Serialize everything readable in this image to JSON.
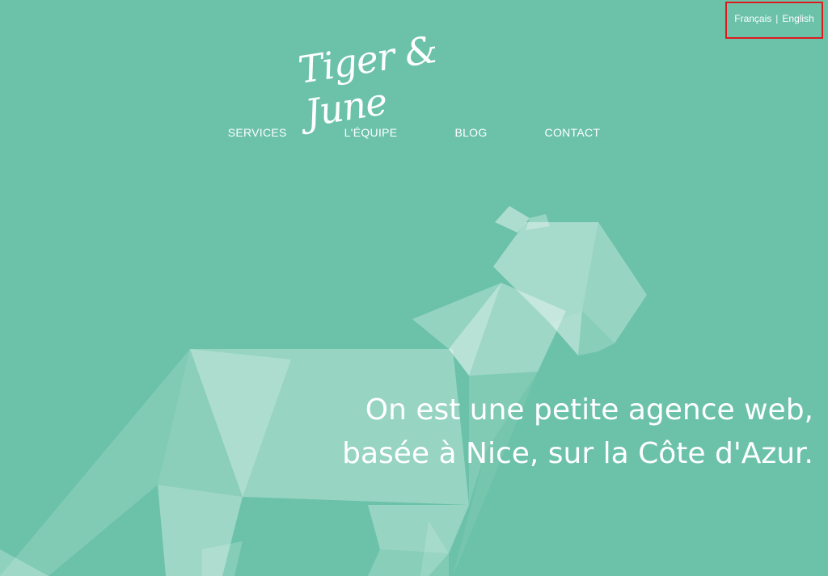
{
  "lang": {
    "french": "Français",
    "separator": "|",
    "english": "English"
  },
  "logo": {
    "text": "Tiger & June"
  },
  "nav": {
    "items": [
      "SERVICES",
      "L'ÉQUIPE",
      "BLOG",
      "CONTACT"
    ]
  },
  "hero": {
    "line1": "On est une petite agence web,",
    "line2": "basée à Nice, sur la Côte d'Azur."
  },
  "colors": {
    "background": "#6bc2a8",
    "highlight_border": "#e0191f",
    "text": "#ffffff"
  }
}
